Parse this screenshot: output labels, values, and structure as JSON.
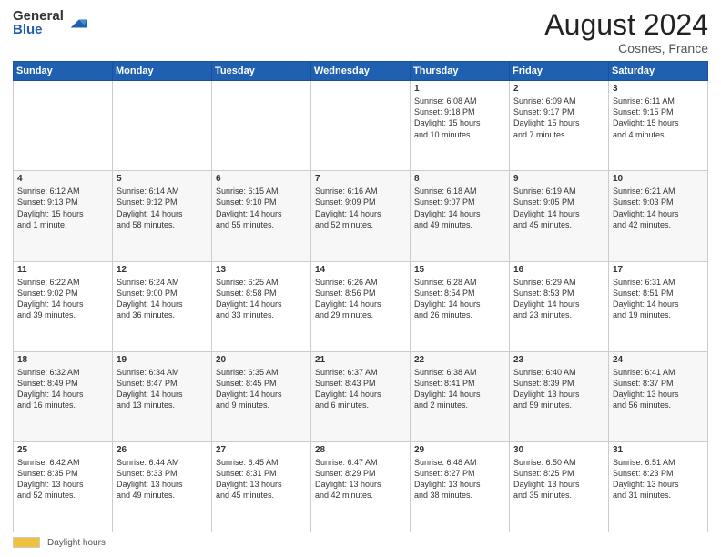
{
  "header": {
    "logo_general": "General",
    "logo_blue": "Blue",
    "month_year": "August 2024",
    "location": "Cosnes, France"
  },
  "footer": {
    "label": "Daylight hours"
  },
  "days_of_week": [
    "Sunday",
    "Monday",
    "Tuesday",
    "Wednesday",
    "Thursday",
    "Friday",
    "Saturday"
  ],
  "weeks": [
    [
      {
        "day": "",
        "info": ""
      },
      {
        "day": "",
        "info": ""
      },
      {
        "day": "",
        "info": ""
      },
      {
        "day": "",
        "info": ""
      },
      {
        "day": "1",
        "info": "Sunrise: 6:08 AM\nSunset: 9:18 PM\nDaylight: 15 hours\nand 10 minutes."
      },
      {
        "day": "2",
        "info": "Sunrise: 6:09 AM\nSunset: 9:17 PM\nDaylight: 15 hours\nand 7 minutes."
      },
      {
        "day": "3",
        "info": "Sunrise: 6:11 AM\nSunset: 9:15 PM\nDaylight: 15 hours\nand 4 minutes."
      }
    ],
    [
      {
        "day": "4",
        "info": "Sunrise: 6:12 AM\nSunset: 9:13 PM\nDaylight: 15 hours\nand 1 minute."
      },
      {
        "day": "5",
        "info": "Sunrise: 6:14 AM\nSunset: 9:12 PM\nDaylight: 14 hours\nand 58 minutes."
      },
      {
        "day": "6",
        "info": "Sunrise: 6:15 AM\nSunset: 9:10 PM\nDaylight: 14 hours\nand 55 minutes."
      },
      {
        "day": "7",
        "info": "Sunrise: 6:16 AM\nSunset: 9:09 PM\nDaylight: 14 hours\nand 52 minutes."
      },
      {
        "day": "8",
        "info": "Sunrise: 6:18 AM\nSunset: 9:07 PM\nDaylight: 14 hours\nand 49 minutes."
      },
      {
        "day": "9",
        "info": "Sunrise: 6:19 AM\nSunset: 9:05 PM\nDaylight: 14 hours\nand 45 minutes."
      },
      {
        "day": "10",
        "info": "Sunrise: 6:21 AM\nSunset: 9:03 PM\nDaylight: 14 hours\nand 42 minutes."
      }
    ],
    [
      {
        "day": "11",
        "info": "Sunrise: 6:22 AM\nSunset: 9:02 PM\nDaylight: 14 hours\nand 39 minutes."
      },
      {
        "day": "12",
        "info": "Sunrise: 6:24 AM\nSunset: 9:00 PM\nDaylight: 14 hours\nand 36 minutes."
      },
      {
        "day": "13",
        "info": "Sunrise: 6:25 AM\nSunset: 8:58 PM\nDaylight: 14 hours\nand 33 minutes."
      },
      {
        "day": "14",
        "info": "Sunrise: 6:26 AM\nSunset: 8:56 PM\nDaylight: 14 hours\nand 29 minutes."
      },
      {
        "day": "15",
        "info": "Sunrise: 6:28 AM\nSunset: 8:54 PM\nDaylight: 14 hours\nand 26 minutes."
      },
      {
        "day": "16",
        "info": "Sunrise: 6:29 AM\nSunset: 8:53 PM\nDaylight: 14 hours\nand 23 minutes."
      },
      {
        "day": "17",
        "info": "Sunrise: 6:31 AM\nSunset: 8:51 PM\nDaylight: 14 hours\nand 19 minutes."
      }
    ],
    [
      {
        "day": "18",
        "info": "Sunrise: 6:32 AM\nSunset: 8:49 PM\nDaylight: 14 hours\nand 16 minutes."
      },
      {
        "day": "19",
        "info": "Sunrise: 6:34 AM\nSunset: 8:47 PM\nDaylight: 14 hours\nand 13 minutes."
      },
      {
        "day": "20",
        "info": "Sunrise: 6:35 AM\nSunset: 8:45 PM\nDaylight: 14 hours\nand 9 minutes."
      },
      {
        "day": "21",
        "info": "Sunrise: 6:37 AM\nSunset: 8:43 PM\nDaylight: 14 hours\nand 6 minutes."
      },
      {
        "day": "22",
        "info": "Sunrise: 6:38 AM\nSunset: 8:41 PM\nDaylight: 14 hours\nand 2 minutes."
      },
      {
        "day": "23",
        "info": "Sunrise: 6:40 AM\nSunset: 8:39 PM\nDaylight: 13 hours\nand 59 minutes."
      },
      {
        "day": "24",
        "info": "Sunrise: 6:41 AM\nSunset: 8:37 PM\nDaylight: 13 hours\nand 56 minutes."
      }
    ],
    [
      {
        "day": "25",
        "info": "Sunrise: 6:42 AM\nSunset: 8:35 PM\nDaylight: 13 hours\nand 52 minutes."
      },
      {
        "day": "26",
        "info": "Sunrise: 6:44 AM\nSunset: 8:33 PM\nDaylight: 13 hours\nand 49 minutes."
      },
      {
        "day": "27",
        "info": "Sunrise: 6:45 AM\nSunset: 8:31 PM\nDaylight: 13 hours\nand 45 minutes."
      },
      {
        "day": "28",
        "info": "Sunrise: 6:47 AM\nSunset: 8:29 PM\nDaylight: 13 hours\nand 42 minutes."
      },
      {
        "day": "29",
        "info": "Sunrise: 6:48 AM\nSunset: 8:27 PM\nDaylight: 13 hours\nand 38 minutes."
      },
      {
        "day": "30",
        "info": "Sunrise: 6:50 AM\nSunset: 8:25 PM\nDaylight: 13 hours\nand 35 minutes."
      },
      {
        "day": "31",
        "info": "Sunrise: 6:51 AM\nSunset: 8:23 PM\nDaylight: 13 hours\nand 31 minutes."
      }
    ]
  ]
}
